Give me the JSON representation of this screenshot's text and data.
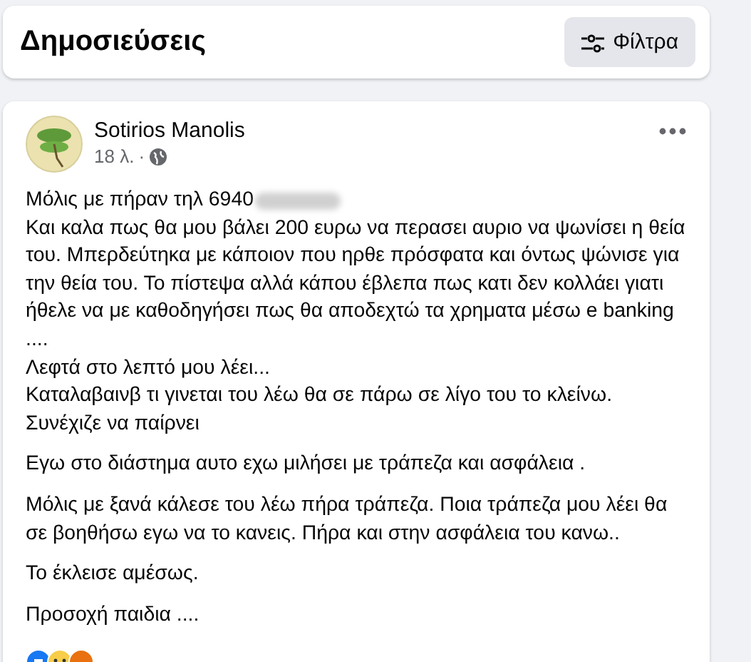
{
  "header": {
    "title": "Δημοσιεύσεις",
    "filter_button": "Φίλτρα"
  },
  "post": {
    "author": "Sotirios Manolis",
    "time": "18 λ.",
    "separator": "·",
    "paragraphs": [
      "Μόλις με πήραν τηλ 6940",
      "Και καλα πως θα μου βάλει 200 ευρω να περασει αυριο να ψωνίσει η θεία του. Μπερδεύτηκα με κάποιον που ηρθε πρόσφατα και όντως ψώνισε για την θεία του. Το πίστεψα αλλά κάπου έβλεπα πως κατι δεν κολλάει γιατι ήθελε να με καθοδηγήσει πως θα αποδεχτώ τα χρηματα μέσω e banking ....\nΛεφτά στο λεπτό μου λέει...\nΚαταλαβαινβ τι γινεται του λέω θα σε πάρω σε λίγο του το κλείνω.\nΣυνέχιζε να παίρνει",
      "Εγω στο διάστημα αυτο εχω μιλήσει με τράπεζα και ασφάλεια .",
      "Μόλις με ξανά κάλεσε του λέω πήρα τράπεζα. Ποια τράπεζα μου λέει θα σε βοηθήσω εγω να το κανεις. Πήρα και στην ασφάλεια του κανω..",
      "Το έκλεισε αμέσως.",
      "Προσοχή παιδια ...."
    ]
  }
}
